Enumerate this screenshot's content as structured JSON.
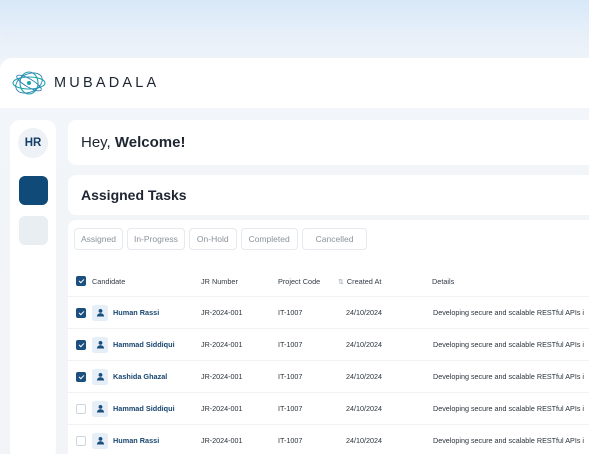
{
  "brand": {
    "name": "MUBADALA"
  },
  "sidebar": {
    "avatar_initials": "HR"
  },
  "welcome": {
    "greeting": "Hey,",
    "emphasis": "Welcome!"
  },
  "tasks": {
    "title": "Assigned Tasks",
    "filters": [
      "Assigned",
      "In-Progress",
      "On-Hold",
      "Completed",
      "Cancelled"
    ],
    "columns": {
      "candidate": "Candidate",
      "jr_number": "JR Number",
      "project_code": "Project Code",
      "created_at": "Created At",
      "details": "Details"
    },
    "header_checked": true,
    "rows": [
      {
        "checked": true,
        "candidate": "Human Rassi",
        "jr_number": "JR-2024-001",
        "project_code": "IT-1007",
        "created_at": "24/10/2024",
        "details": "Developing secure and scalable RESTful APIs i"
      },
      {
        "checked": true,
        "candidate": "Hammad Siddiqui",
        "jr_number": "JR-2024-001",
        "project_code": "IT-1007",
        "created_at": "24/10/2024",
        "details": "Developing secure and scalable RESTful APIs i"
      },
      {
        "checked": true,
        "candidate": "Kashida Ghazal",
        "jr_number": "JR-2024-001",
        "project_code": "IT-1007",
        "created_at": "24/10/2024",
        "details": "Developing secure and scalable RESTful APIs i"
      },
      {
        "checked": false,
        "candidate": "Hammad Siddiqui",
        "jr_number": "JR-2024-001",
        "project_code": "IT-1007",
        "created_at": "24/10/2024",
        "details": "Developing secure and scalable RESTful APIs i"
      },
      {
        "checked": false,
        "candidate": "Human Rassi",
        "jr_number": "JR-2024-001",
        "project_code": "IT-1007",
        "created_at": "24/10/2024",
        "details": "Developing secure and scalable RESTful APIs i"
      }
    ]
  },
  "colors": {
    "brand_primary": "#0f4a78",
    "accent_teal": "#1aa6a6"
  },
  "icons": {
    "logo": "globe-logo-icon",
    "user": "user-icon",
    "sort": "sort-icon"
  }
}
